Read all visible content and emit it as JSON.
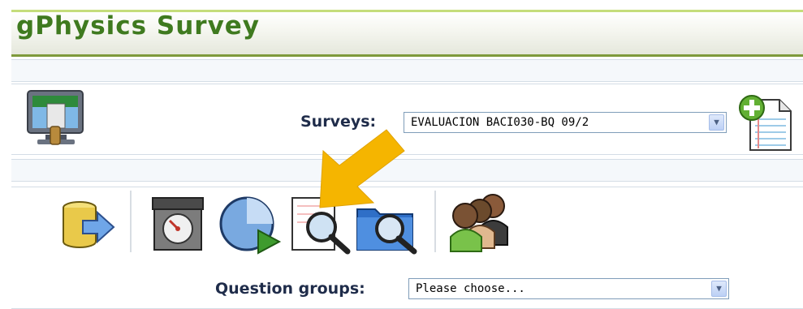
{
  "app": {
    "title": "gPhysics Survey"
  },
  "surveys": {
    "label": "Surveys:",
    "selected": "EVALUACION BACI030-BQ 09/2"
  },
  "question_groups": {
    "label": "Question groups:",
    "selected": "Please choose..."
  },
  "icons": {
    "admin": "screen-brush-icon",
    "add_survey": "add-document-icon",
    "database_export": "database-export-icon",
    "timer": "timer-icon",
    "activate": "activate-play-icon",
    "browse_responses": "document-magnifier-icon",
    "browse_folder": "folder-magnifier-icon",
    "participants": "users-group-icon",
    "pointer": "yellow-arrow-icon"
  },
  "colors": {
    "title": "#3f7a1f",
    "title_border": "#7e9a3c",
    "label": "#1f2c4a",
    "arrow": "#f5b500"
  }
}
